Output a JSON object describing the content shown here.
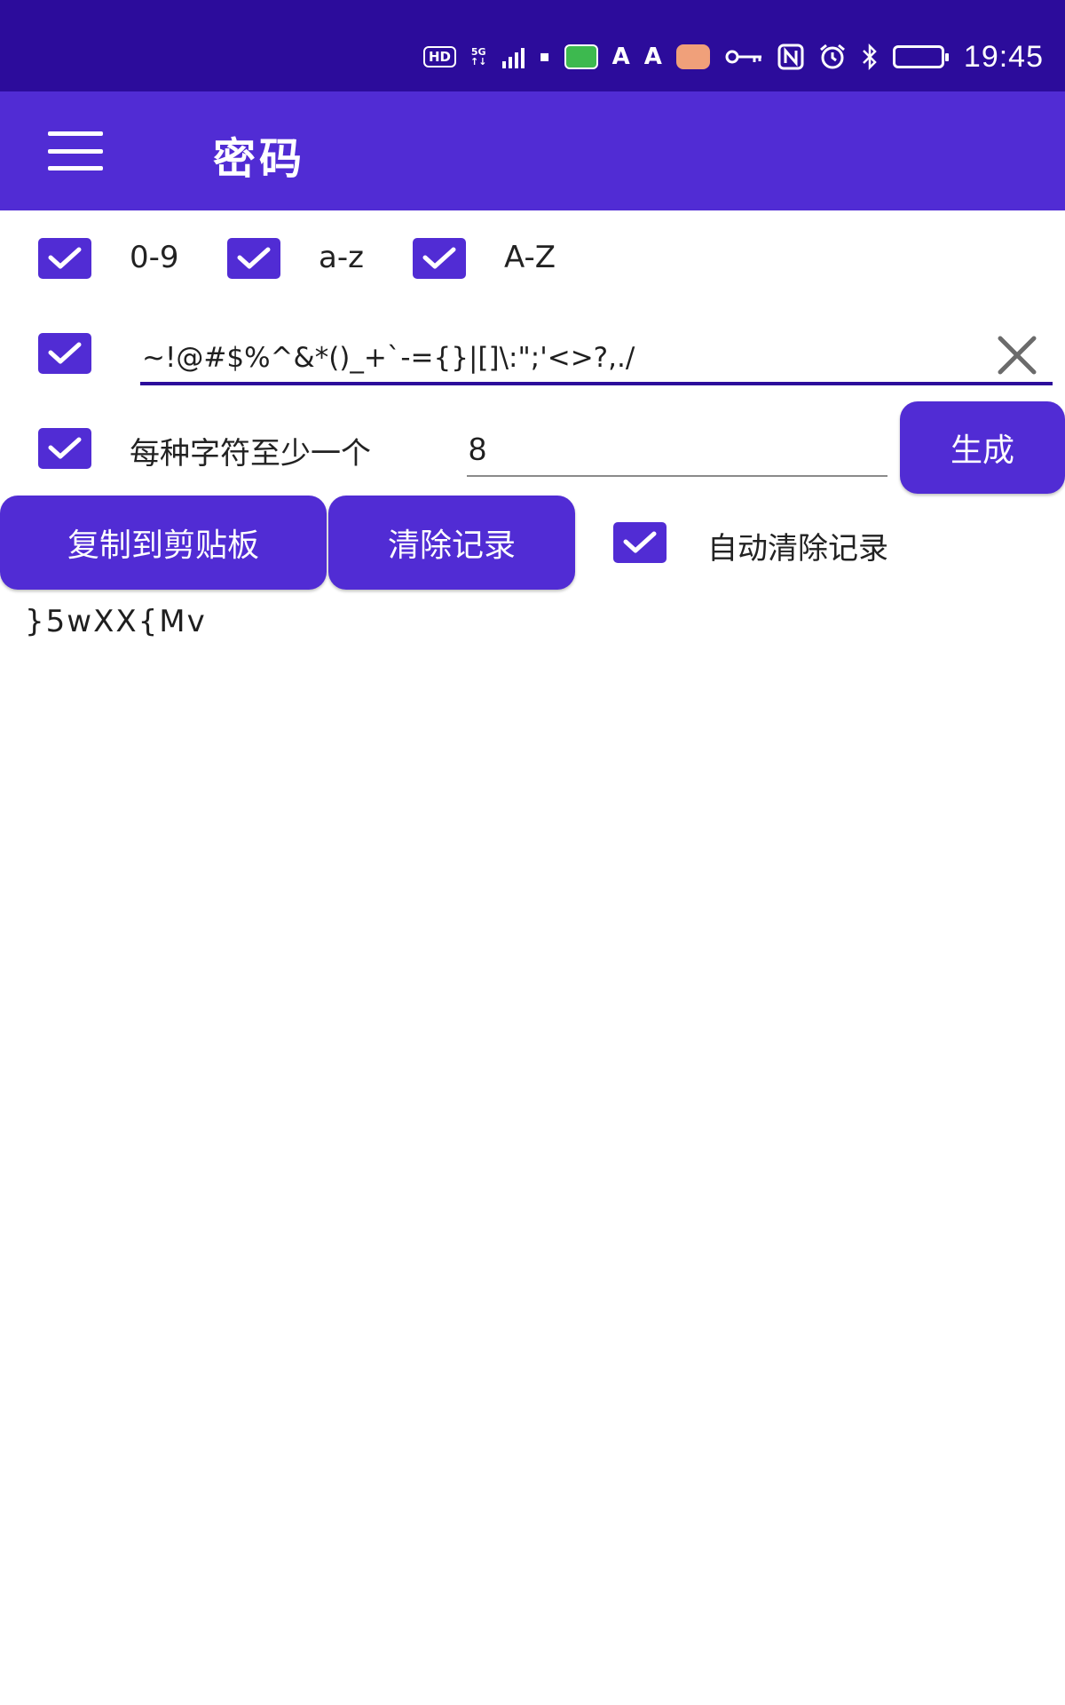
{
  "status_bar": {
    "time": "19:45",
    "hd": "HD",
    "network": "5G",
    "icons": [
      "hd-icon",
      "signal-5g-icon",
      "data-icon",
      "app-store-icon",
      "font-a-icon",
      "font-a2-icon",
      "message-icon",
      "key-icon",
      "nfc-icon",
      "alarm-icon",
      "bluetooth-icon",
      "battery-icon"
    ]
  },
  "app_bar": {
    "title": "密码",
    "menu_icon": "menu-icon"
  },
  "options": {
    "digits": {
      "label": "0-9",
      "checked": true
    },
    "lowercase": {
      "label": "a-z",
      "checked": true
    },
    "uppercase": {
      "label": "A-Z",
      "checked": true
    },
    "symbols": {
      "checked": true,
      "value": "~!@#$%^&*()_+`-={}|[]\\:\";'<>?,./"
    },
    "each_at_least_one": {
      "label": "每种字符至少一个",
      "checked": true
    },
    "length": "8"
  },
  "buttons": {
    "generate": "生成",
    "copy": "复制到剪贴板",
    "clear_history": "清除记录"
  },
  "auto_clear": {
    "label": "自动清除记录",
    "checked": true
  },
  "result": "}5wXX{Mv",
  "colors": {
    "status_bar": "#2c0c9b",
    "app_bar": "#512cd4",
    "accent": "#512cd4",
    "underline_active": "#2c0c9b"
  }
}
